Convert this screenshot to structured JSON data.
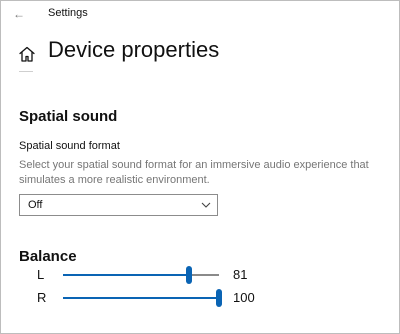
{
  "titlebar": {
    "back_icon": "back-arrow-icon",
    "app_title": "Settings"
  },
  "header": {
    "home_icon": "home-icon",
    "page_title": "Device properties"
  },
  "spatial_sound": {
    "heading": "Spatial sound",
    "format_label": "Spatial sound format",
    "description": "Select your spatial sound format for an immersive audio experience that simulates a more realistic environment.",
    "format_selected": "Off",
    "dropdown_icon": "chevron-down-icon"
  },
  "balance": {
    "heading": "Balance",
    "left": {
      "label": "L",
      "value": 81,
      "value_text": "81"
    },
    "right": {
      "label": "R",
      "value": 100,
      "value_text": "100"
    },
    "max": 100
  },
  "colors": {
    "accent": "#0a64b4",
    "track": "#8a8a8a",
    "secondary_text": "#767676"
  }
}
